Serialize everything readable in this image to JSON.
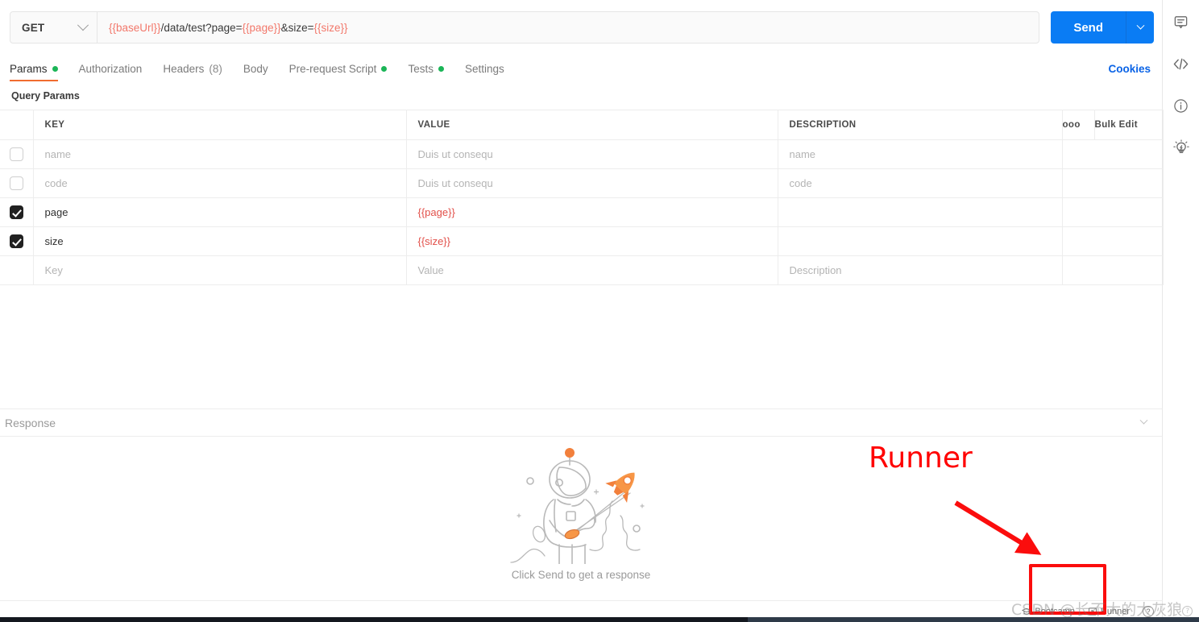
{
  "request": {
    "method": "GET",
    "url_parts": [
      {
        "text": "{{baseUrl}}",
        "kind": "var"
      },
      {
        "text": "/data/test?page=",
        "kind": "plain"
      },
      {
        "text": "{{page}}",
        "kind": "var"
      },
      {
        "text": "&size=",
        "kind": "plain"
      },
      {
        "text": "{{size}}",
        "kind": "var"
      }
    ],
    "url_full": "{{baseUrl}}/data/test?page={{page}}&size={{size}}",
    "send_label": "Send"
  },
  "tabs": [
    {
      "label": "Params",
      "active": true,
      "dot": true,
      "count": ""
    },
    {
      "label": "Authorization",
      "active": false,
      "dot": false,
      "count": ""
    },
    {
      "label": "Headers",
      "active": false,
      "dot": false,
      "count": "(8)"
    },
    {
      "label": "Body",
      "active": false,
      "dot": false,
      "count": ""
    },
    {
      "label": "Pre-request Script",
      "active": false,
      "dot": true,
      "count": ""
    },
    {
      "label": "Tests",
      "active": false,
      "dot": true,
      "count": ""
    },
    {
      "label": "Settings",
      "active": false,
      "dot": false,
      "count": ""
    }
  ],
  "cookies_label": "Cookies",
  "query_params": {
    "section_title": "Query Params",
    "headers": {
      "key": "KEY",
      "value": "VALUE",
      "description": "DESCRIPTION",
      "bulk_edit": "Bulk Edit",
      "more": "ooo"
    },
    "rows": [
      {
        "checked": false,
        "key": "name",
        "key_muted": true,
        "value": "Duis ut consequ",
        "value_style": "muted",
        "description": "name",
        "desc_muted": true
      },
      {
        "checked": false,
        "key": "code",
        "key_muted": true,
        "value": "Duis ut consequ",
        "value_style": "muted",
        "description": "code",
        "desc_muted": true
      },
      {
        "checked": true,
        "key": "page",
        "key_muted": false,
        "value": "{{page}}",
        "value_style": "red",
        "description": "",
        "desc_muted": true
      },
      {
        "checked": true,
        "key": "size",
        "key_muted": false,
        "value": "{{size}}",
        "value_style": "red",
        "description": "",
        "desc_muted": true
      },
      {
        "checked": false,
        "key": "Key",
        "key_muted": true,
        "value": "Value",
        "value_style": "muted",
        "description": "Description",
        "desc_muted": true
      }
    ]
  },
  "response": {
    "label": "Response",
    "empty_caption": "Click Send to get a response"
  },
  "footer": {
    "bootcamp": "Bootcamp",
    "runner": "Runner",
    "help": "?"
  },
  "right_rail": [
    {
      "name": "comment-icon"
    },
    {
      "name": "code-icon"
    },
    {
      "name": "info-icon"
    },
    {
      "name": "lightbulb-icon"
    }
  ],
  "annotations": {
    "runner_label": "Runner",
    "watermark": "CSDN @长不大的大灰狼",
    "accent_red": "#ff0000",
    "box_red": "#fb0d0d"
  },
  "colors": {
    "send_blue": "#0a7cf4",
    "tab_accent": "#f06c30",
    "dot_green": "#1bb557",
    "variable_red": "#f2786b",
    "value_red": "#e2504a",
    "link_blue": "#0a63e6"
  }
}
